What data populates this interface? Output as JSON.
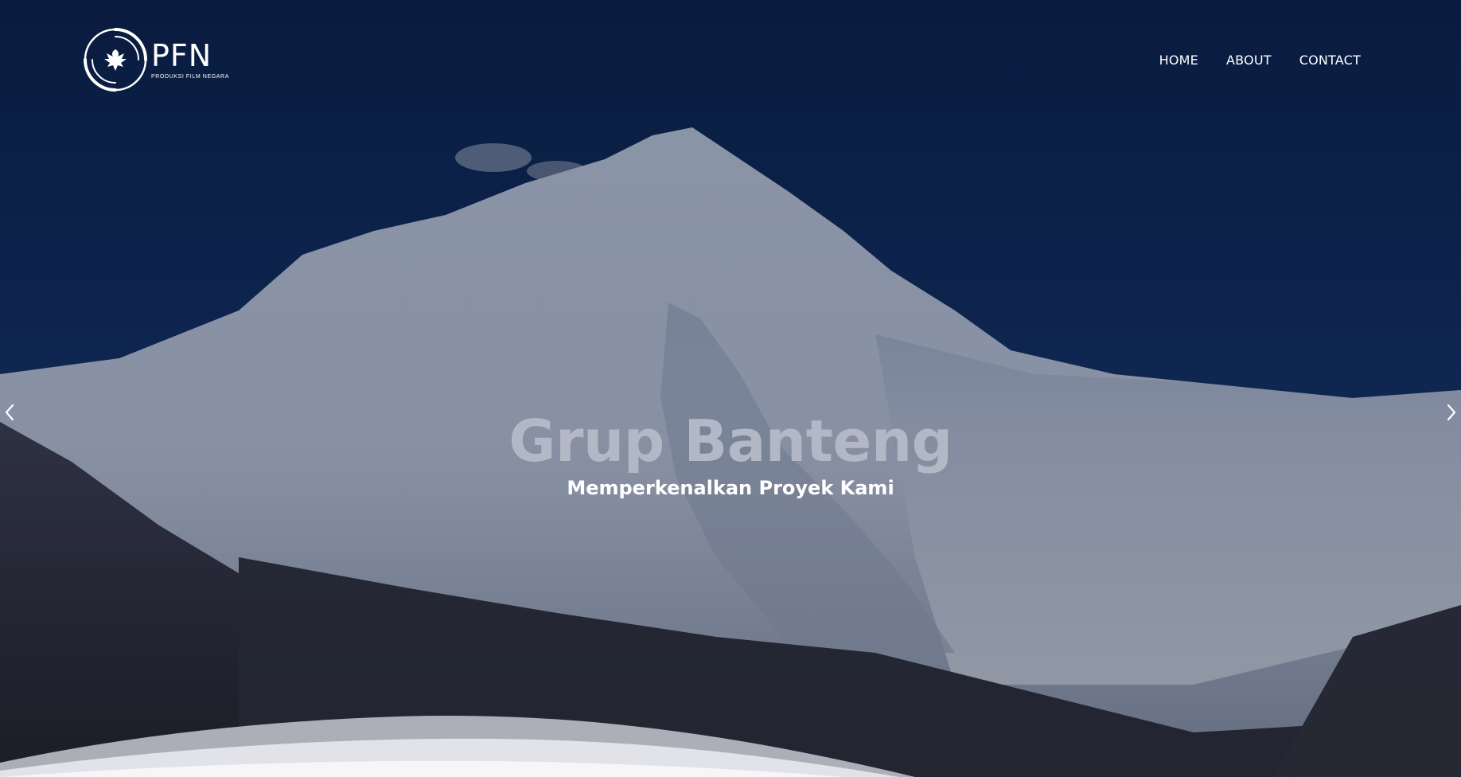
{
  "brand": {
    "name": "PFN",
    "tagline": "PRODUKSI FILM NEGARA"
  },
  "nav": {
    "items": [
      {
        "label": "HOME"
      },
      {
        "label": "ABOUT"
      },
      {
        "label": "CONTACT"
      }
    ]
  },
  "hero": {
    "title": "Grup Banteng",
    "subtitle": "Memperkenalkan Proyek Kami",
    "prev_icon": "chevron-left-icon",
    "next_icon": "chevron-right-icon"
  },
  "colors": {
    "sky": "#0b2454",
    "title": "#b2b8c6",
    "text": "#ffffff"
  }
}
